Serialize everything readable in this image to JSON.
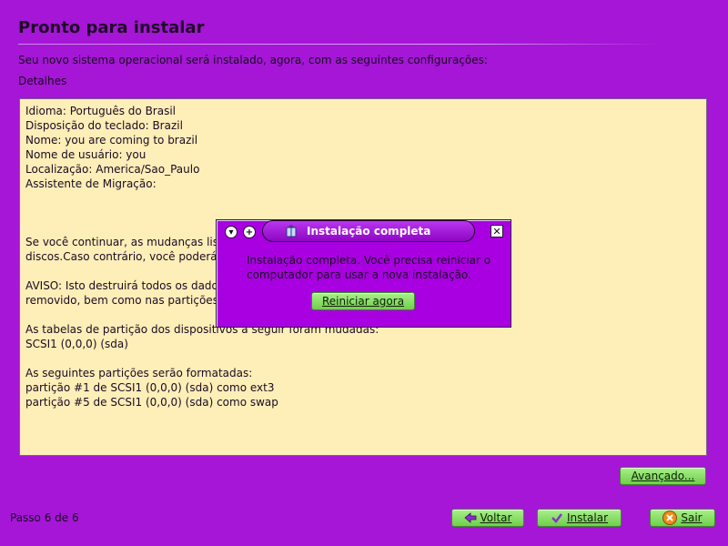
{
  "page": {
    "title": "Pronto para instalar",
    "intro": "Seu novo sistema operacional será instalado, agora, com as seguintes configurações:",
    "details_label": "Detalhes"
  },
  "details": {
    "lines": [
      "Idioma: Português do Brasil",
      "Disposição do teclado: Brazil",
      "Nome: you are coming to brazil",
      "Nome de usuário: you",
      "Localização: America/Sao_Paulo",
      "Assistente de Migração:",
      "",
      "",
      "",
      "Se você continuar, as mudanças lis",
      "discos.Caso contrário, você poderá",
      "",
      "AVISO: Isto destruirá todos os dado",
      "removido, bem como nas partições",
      "",
      "As tabelas de partição dos dispositivos a seguir foram mudadas:",
      "SCSI1 (0,0,0) (sda)",
      "",
      "As seguintes partições serão formatadas:",
      "partição #1 de SCSI1 (0,0,0) (sda) como ext3",
      "partição #5 de SCSI1 (0,0,0) (sda) como swap"
    ]
  },
  "buttons": {
    "advanced": "Avançado...",
    "back": "Voltar",
    "install": "Instalar",
    "quit": "Sair"
  },
  "footer": {
    "step": "Passo 6 de 6"
  },
  "dialog": {
    "title": "Instalação completa",
    "message": "Instalação completa. Você precisa reiniciar o computador para usar a nova instalação.",
    "restart_label": "Reiniciar agora",
    "minimize_glyph": "▾",
    "maximize_glyph": "+",
    "close_glyph": "✕"
  },
  "icons": {
    "back": "back-arrow-icon",
    "install": "checkmark-icon",
    "quit": "close-circle-icon",
    "package": "package-icon"
  },
  "colors": {
    "background": "#a516d6",
    "details_bg": "#feeeb8",
    "button": "#7fd85a",
    "dialog": "#a800e0"
  }
}
